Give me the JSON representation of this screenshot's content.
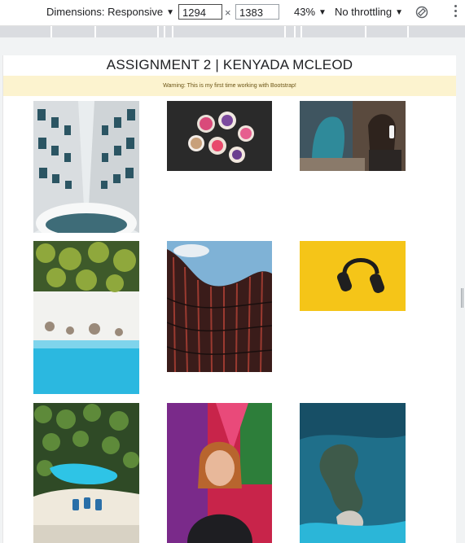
{
  "devtools": {
    "dimensions_label": "Dimensions: Responsive",
    "width_value": "1294",
    "times_symbol": "×",
    "height_value": "1383",
    "zoom_label": "43%",
    "throttle_label": "No throttling",
    "caret": "▼"
  },
  "page": {
    "title": "ASSIGNMENT 2 | KENYADA MCLEOD",
    "alert_text": "Warning: This is my first time working with Bootstrap!"
  },
  "gallery": {
    "images": [
      {
        "subject": "building-looking-up"
      },
      {
        "subject": "donuts"
      },
      {
        "subject": "woman-headphones-mural"
      },
      {
        "subject": "palm-beach-aerial"
      },
      {
        "subject": "curved-building"
      },
      {
        "subject": "headphones-yellow"
      },
      {
        "subject": "tropical-lagoon-aerial"
      },
      {
        "subject": "boy-graffiti"
      },
      {
        "subject": "reef-aerial"
      }
    ]
  },
  "colors": {
    "alert_bg": "#fcf3cf",
    "alert_text": "#6b5415",
    "headphones_bg": "#f5c518",
    "lagoon": "#2ec4e6"
  }
}
